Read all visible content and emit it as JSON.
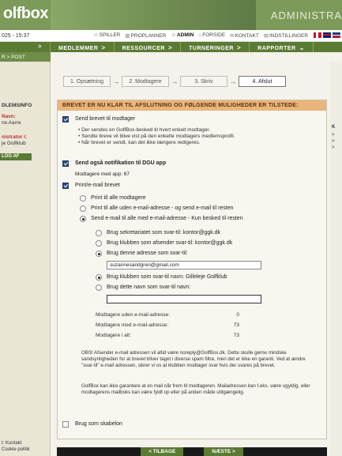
{
  "header": {
    "logo": "olfbox",
    "title": "ADMINISTRA",
    "clock": "025 - 15:37",
    "utility_links": [
      {
        "icon": "user-icon",
        "label": "SPILLER"
      },
      {
        "icon": "calendar-icon",
        "label": "PROPLANNER"
      },
      {
        "icon": "user-icon",
        "label": "ADMIN"
      },
      {
        "icon": "home-icon",
        "label": "FORSIDE"
      },
      {
        "icon": "mail-icon",
        "label": "KONTAKT"
      },
      {
        "icon": "settings-icon",
        "label": "INDSTILLINGER"
      }
    ]
  },
  "nav": {
    "items": [
      "MEDLEMMER",
      "RESSOURCER",
      "TURNERINGER",
      "RAPPORTER"
    ],
    "breadcrumb": "R > POST"
  },
  "sidebar": {
    "title": "DLEMSINFO",
    "name_label": "Navn:",
    "name_value": "ne Aarre",
    "admin_label": "nistrator i:",
    "admin_value": "je Golfklub",
    "logout": "LOG AF",
    "foot_1": "t: Kontakt",
    "foot_2": "Cookie politik"
  },
  "wizard": {
    "steps": [
      "1. Opsætning",
      "2. Modtagere",
      "3. Skriv",
      "4. Afslut"
    ]
  },
  "panel": {
    "heading": "BREVET ER NU KLAR TIL AFSLUTNING OG FØLGENDE MULIGHEDER ER TILSTEDE:",
    "send_letter": "Send brevet til modtager",
    "bullets": [
      "Der sendes en GolfBox-besked til hvert enkelt modtager.",
      "Sendte breve vil blive vist på den enkelte modtagers medlemsprofil.",
      "Når brevet er sendt, kan det ikke længere redigeres."
    ],
    "dgu_notify": "Send også notifikation til DGU app",
    "dgu_count": "Modtagere med app: 67",
    "print_email": "Print/e-mail brevet",
    "options": [
      "Print til alle modtagere",
      "Print til alle uden e-mail-adresse - og send e-mail til resten",
      "Send e-mail til alle med e-mail-adresse - Kun besked til resten"
    ],
    "reply_options": [
      "Brug sekretariatet som svar-til: kontor@ggk.dk",
      "Brug klubben som afsender svar-til: kontor@ggk.dk",
      "Brug denne adresse som svar-til:"
    ],
    "reply_input": "suzannesandgren@gmail.com",
    "name_options": [
      "Brug klubben som svar-til navn: Gilleleje Golfklub",
      "Brug dette navn som svar-til navn:"
    ],
    "name_input": "",
    "stats": [
      {
        "label": "Modtagere uden e-mail-adresse:",
        "value": "0"
      },
      {
        "label": "Modtagere med e-mail-adresse:",
        "value": "73"
      },
      {
        "label": "Modtagere i alt:",
        "value": "73"
      }
    ],
    "note_1": "OBS! Afsender e-mail adressen vil altid være noreply@GolfBox.dk. Dette skulle gerne mindske sandsynligheden for at brevet bliver taget i diverse spam filtre, men det er ikke en garanti. Ved at ændre \"svar-til\" e-mail adressen, sikrer vi os at klubben modtager svar hvis der svares på brevet.",
    "note_2": "GolfBox kan ikke garantere at en mail når frem til modtageren. Mailadressen kan f.eks. være ugyldig, eller modtagerens mailboks kan være fyldt op eller på anden måde utilgængelig.",
    "template": "Brug som skabelon"
  },
  "buttons": {
    "back": "< TILBAGE",
    "next": "NÆSTE >"
  },
  "rightstrip": {
    "label": "K"
  }
}
